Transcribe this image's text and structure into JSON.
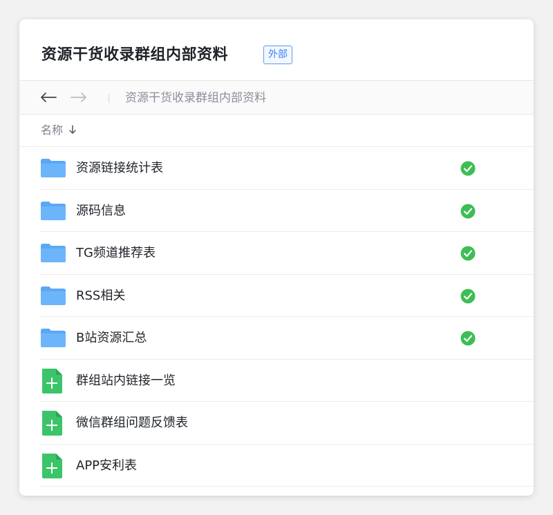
{
  "header": {
    "title": "资源干货收录群组内部资料",
    "badge": "外部"
  },
  "nav": {
    "breadcrumb": "资源干货收录群组内部资料"
  },
  "column": {
    "name_label": "名称"
  },
  "colors": {
    "folder": "#5aa8f5",
    "sheet": "#3cc46a",
    "status_ok": "#3dbe55",
    "badge": "#3b82f6"
  },
  "items": [
    {
      "name": "资源链接统计表",
      "type": "folder",
      "synced": true
    },
    {
      "name": "源码信息",
      "type": "folder",
      "synced": true
    },
    {
      "name": "TG频道推荐表",
      "type": "folder",
      "synced": true
    },
    {
      "name": "RSS相关",
      "type": "folder",
      "synced": true
    },
    {
      "name": "B站资源汇总",
      "type": "folder",
      "synced": true
    },
    {
      "name": "群组站内链接一览",
      "type": "sheet",
      "synced": false
    },
    {
      "name": "微信群组问题反馈表",
      "type": "sheet",
      "synced": false
    },
    {
      "name": "APP安利表",
      "type": "sheet",
      "synced": false
    }
  ]
}
